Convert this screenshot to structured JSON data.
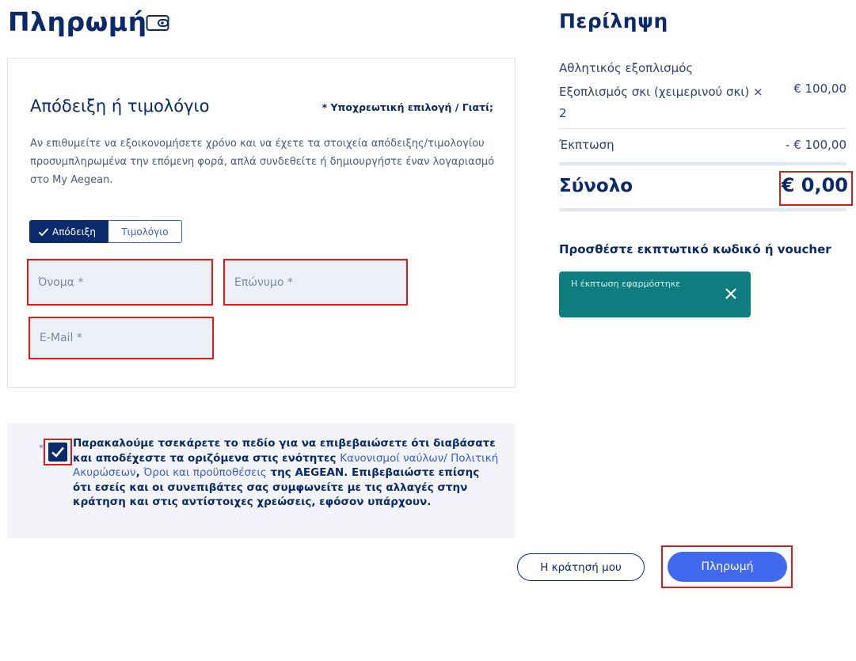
{
  "header": {
    "title": "Πληρωμή",
    "icon": "wallet-icon"
  },
  "invoice": {
    "title": "Απόδειξη ή τιμολόγιο",
    "required_note": "* Υποχρεωτική επιλογή / Γιατί;",
    "description": "Αν επιθυμείτε να εξοικονομήσετε χρόνο και να έχετε τα στοιχεία απόδειξης/τιμολογίου προσυμπληρωμένα την επόμενη φορά, απλά συνδεθείτε ή δημιουργήστε έναν λογαριασμό στο My Aegean.",
    "toggle": {
      "receipt_label": "Απόδειξη",
      "invoice_label": "Τιμολόγιο",
      "selected": "receipt"
    },
    "fields": {
      "first_name_placeholder": "Όνομα *",
      "last_name_placeholder": "Επώνυμο *",
      "email_placeholder": "E-Mail *"
    }
  },
  "consent": {
    "asterisk": "*",
    "checked": true,
    "text_part1": "Παρακαλούμε τσεκάρετε το πεδίο για να επιβεβαιώσετε ότι διαβάσατε και αποδέχεστε τα οριζόμενα στις ενότητες ",
    "link1": "Κανονισμοί ναύλων/ Πολιτική Ακυρώσεων",
    "separator": ",   ",
    "link2": "Όροι και προϋποθέσεις",
    "text_part2": " της AEGEAN. Επιβεβαιώστε επίσης ότι εσείς και οι συνεπιβάτες σας συμφωνείτε με τις αλλαγές στην κράτηση και στις αντίστοιχες χρεώσεις, εφόσον υπάρχουν."
  },
  "actions": {
    "my_booking_label": "Η κράτησή μου",
    "pay_label": "Πληρωμή"
  },
  "summary": {
    "title": "Περίληψη",
    "category": "Αθλητικός εξοπλισμός",
    "item_label": "Εξοπλισμός σκι (χειμερινού σκι) × 2",
    "item_price": "€ 100,00",
    "discount_label": "Έκπτωση",
    "discount_value": "- € 100,00",
    "total_label": "Σύνολο",
    "total_value": "€ 0,00"
  },
  "voucher": {
    "title": "Προσθέστε εκπτωτικό κωδικό ή voucher",
    "message": "Η έκπτωση εφαρμόστηκε",
    "close_icon": "close-icon"
  },
  "colors": {
    "primary": "#0a2a6b",
    "accent": "#4169f0",
    "link": "#3a5bd9",
    "success_toast": "#0e7d7f",
    "highlight": "#e01a1a"
  }
}
